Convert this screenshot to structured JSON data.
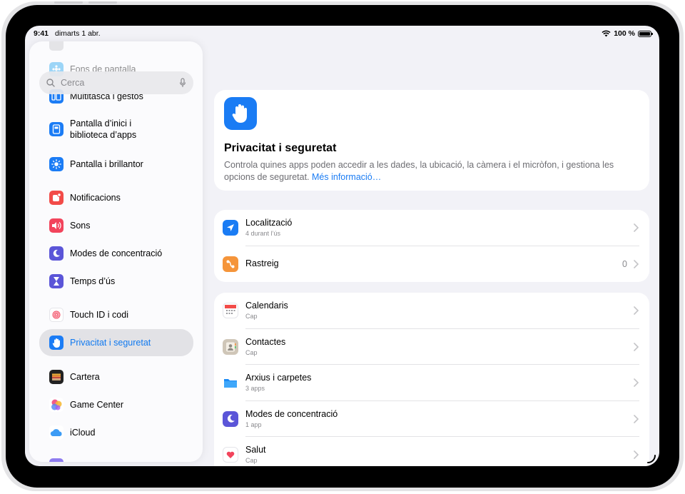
{
  "status": {
    "time": "9:41",
    "date": "dimarts 1 abr.",
    "battery": "100 %"
  },
  "search": {
    "placeholder": "Cerca"
  },
  "sidebar": {
    "items": [
      {
        "label": "Fons de pantalla"
      },
      {
        "label": "Multitasca i gestos"
      },
      {
        "label": "Pantalla d’inici i biblioteca d’apps"
      },
      {
        "label": "Pantalla i brillantor"
      },
      {
        "label": "Notificacions"
      },
      {
        "label": "Sons"
      },
      {
        "label": "Modes de concentració"
      },
      {
        "label": "Temps d’ús"
      },
      {
        "label": "Touch ID i codi"
      },
      {
        "label": "Privacitat i seguretat"
      },
      {
        "label": "Cartera"
      },
      {
        "label": "Game Center"
      },
      {
        "label": "iCloud"
      }
    ]
  },
  "header": {
    "title": "Privacitat i seguretat",
    "description": "Controla quines apps poden accedir a les dades, la ubicació, la càmera i el micròfon, i gestiona les opcions de seguretat.",
    "link": "Més informació…"
  },
  "group1": [
    {
      "title": "Localització",
      "subtitle": "4 durant l’ús",
      "value": ""
    },
    {
      "title": "Rastreig",
      "subtitle": "",
      "value": "0"
    }
  ],
  "group2": [
    {
      "title": "Calendaris",
      "subtitle": "Cap"
    },
    {
      "title": "Contactes",
      "subtitle": "Cap"
    },
    {
      "title": "Arxius i carpetes",
      "subtitle": "3 apps"
    },
    {
      "title": "Modes de concentració",
      "subtitle": "1 app"
    },
    {
      "title": "Salut",
      "subtitle": "Cap"
    }
  ],
  "colors": {
    "accent": "#1079F0",
    "background": "#F2F2F7"
  }
}
